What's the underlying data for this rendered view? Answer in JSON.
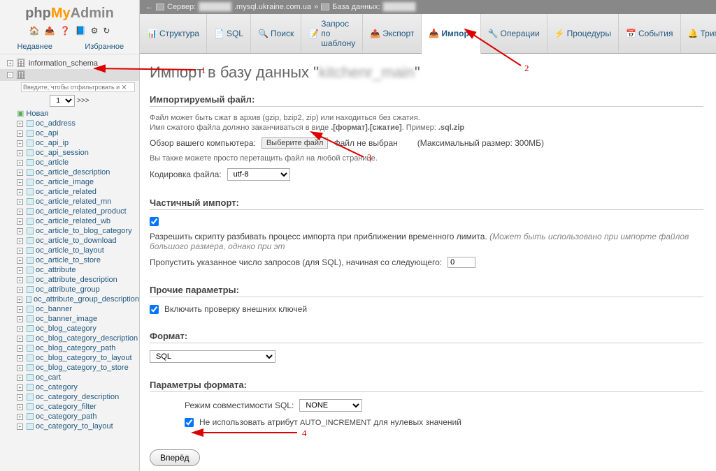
{
  "logo": {
    "php": "php",
    "my": "My",
    "admin": "Admin"
  },
  "sidebar_icons": [
    "🏠",
    "📤",
    "❓",
    "📘",
    "⚙",
    "↻"
  ],
  "sidebar_tabs": {
    "recent": "Недавнее",
    "favorites": "Избранное"
  },
  "db_tree": {
    "information_schema": "information_schema",
    "current_db": "",
    "filter_placeholder": "Введите, чтобы отфильтровать и ✕",
    "page": "1",
    "paging_next": ">>>",
    "new_table": "Новая",
    "tables": [
      "oc_address",
      "oc_api",
      "oc_api_ip",
      "oc_api_session",
      "oc_article",
      "oc_article_description",
      "oc_article_image",
      "oc_article_related",
      "oc_article_related_mn",
      "oc_article_related_product",
      "oc_article_related_wb",
      "oc_article_to_blog_category",
      "oc_article_to_download",
      "oc_article_to_layout",
      "oc_article_to_store",
      "oc_attribute",
      "oc_attribute_description",
      "oc_attribute_group",
      "oc_attribute_group_description",
      "oc_banner",
      "oc_banner_image",
      "oc_blog_category",
      "oc_blog_category_description",
      "oc_blog_category_path",
      "oc_blog_category_to_layout",
      "oc_blog_category_to_store",
      "oc_cart",
      "oc_category",
      "oc_category_description",
      "oc_category_filter",
      "oc_category_path",
      "oc_category_to_layout"
    ]
  },
  "breadcrumb": {
    "server_label": "Сервер:",
    "server": ".mysql.ukraine.com.ua",
    "db_label": "База данных:",
    "db": ""
  },
  "tabs": [
    {
      "icon": "📊",
      "label": "Структура"
    },
    {
      "icon": "📄",
      "label": "SQL"
    },
    {
      "icon": "🔍",
      "label": "Поиск"
    },
    {
      "icon": "📝",
      "label": "Запрос по шаблону"
    },
    {
      "icon": "📤",
      "label": "Экспорт"
    },
    {
      "icon": "📥",
      "label": "Импорт",
      "active": true
    },
    {
      "icon": "🔧",
      "label": "Операции"
    },
    {
      "icon": "⚡",
      "label": "Процедуры"
    },
    {
      "icon": "📅",
      "label": "События"
    },
    {
      "icon": "🔔",
      "label": "Триггеры"
    }
  ],
  "page_title_prefix": "Импорт в базу данных \"",
  "page_title_db": "kitchenr_main",
  "page_title_suffix": "\"",
  "import_file": {
    "legend": "Импортируемый файл:",
    "hint1": "Файл может быть сжат в архив (gzip, bzip2, zip) или находиться без сжатия.",
    "hint2_a": "Имя сжатого файла должно заканчиваться в виде ",
    "hint2_b": ".[формат].[сжатие]",
    "hint2_c": ". Пример: ",
    "hint2_d": ".sql.zip",
    "browse_label": "Обзор вашего компьютера:",
    "choose_btn": "Выберите файл",
    "no_file": "Файл не выбран",
    "max_size": "(Максимальный размер: 300МБ)",
    "drag_hint": "Вы также можете просто перетащить файл на любой странице.",
    "charset_label": "Кодировка файла:",
    "charset": "utf-8"
  },
  "partial": {
    "legend": "Частичный импорт:",
    "allow_label": "Разрешить скрипту разбивать процесс импорта при приближении временного лимита. ",
    "allow_note": "(Может быть использовано при импорте файлов большого размера, однако при эт",
    "skip_label": "Пропустить указанное число запросов (для SQL), начиная со следующего:",
    "skip_value": "0"
  },
  "other": {
    "legend": "Прочие параметры:",
    "fk_label": "Включить проверку внешних ключей"
  },
  "format": {
    "legend": "Формат:",
    "value": "SQL"
  },
  "format_params": {
    "legend": "Параметры формата:",
    "compat_label": "Режим совместимости SQL:",
    "compat_value": "NONE",
    "noai_a": "Не использовать атрибут ",
    "noai_b": "AUTO_INCREMENT",
    "noai_c": " для нулевых значений"
  },
  "submit": "Вперёд",
  "ann": {
    "1": "1",
    "2": "2",
    "3": "3",
    "4": "4"
  }
}
